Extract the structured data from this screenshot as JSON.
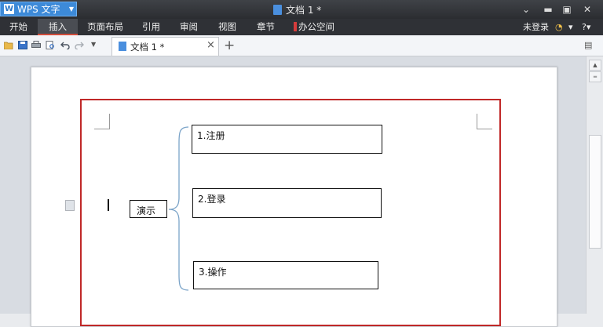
{
  "titlebar": {
    "app_name": "WPS 文字",
    "doc_title": "文档 1 *"
  },
  "menu": {
    "items": [
      "开始",
      "插入",
      "页面布局",
      "引用",
      "审阅",
      "视图",
      "章节",
      "办公空间"
    ],
    "active": "插入",
    "login": "未登录",
    "help": "?"
  },
  "tab": {
    "label": "文档 1 *",
    "close": "×",
    "new": "+"
  },
  "diagram": {
    "center": "演示",
    "items": [
      "1.注册",
      "2.登录",
      "3.操作"
    ]
  },
  "colors": {
    "titlebar": "#2b2d31",
    "wps_button": "#3d8ad8",
    "active_tab_underline": "#d04c3a",
    "page_border": "#c02828"
  }
}
